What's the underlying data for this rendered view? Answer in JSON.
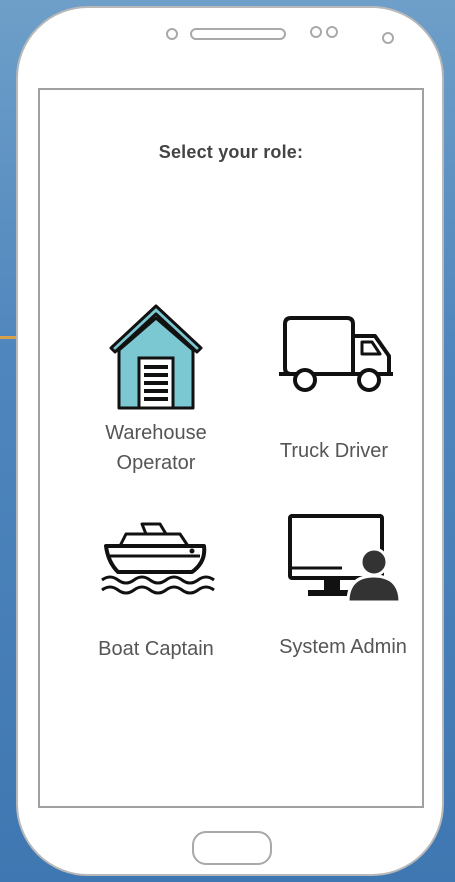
{
  "screen": {
    "title": "Select your role:"
  },
  "roles": [
    {
      "label_line1": "Warehouse",
      "label_line2": "Operator",
      "icon": "warehouse-icon"
    },
    {
      "label": "Truck Driver",
      "icon": "truck-icon"
    },
    {
      "label": "Boat Captain",
      "icon": "boat-icon"
    },
    {
      "label": "System Admin",
      "icon": "computer-user-icon"
    }
  ],
  "colors": {
    "warehouse_fill": "#7cc8d2",
    "icon_stroke": "#111111",
    "background": "#4f86bd"
  }
}
